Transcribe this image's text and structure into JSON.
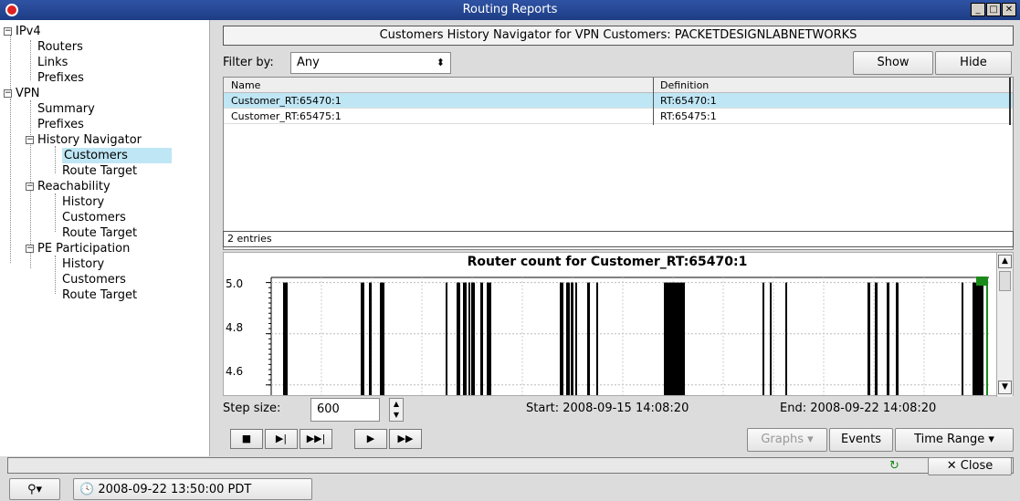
{
  "window": {
    "title": "Routing Reports",
    "controls": [
      "_",
      "□",
      "✕"
    ]
  },
  "tree": {
    "ipv4": "IPv4",
    "routers": "Routers",
    "links": "Links",
    "prefixes4": "Prefixes",
    "vpn": "VPN",
    "summary": "Summary",
    "prefixes_vpn": "Prefixes",
    "history_nav": "History Navigator",
    "hn_customers": "Customers",
    "hn_route_target": "Route Target",
    "reachability": "Reachability",
    "r_history": "History",
    "r_customers": "Customers",
    "r_route_target": "Route Target",
    "pe_participation": "PE Participation",
    "p_history": "History",
    "p_customers": "Customers",
    "p_route_target": "Route Target"
  },
  "header": {
    "title": "Customers History Navigator for VPN Customers: PACKETDESIGNLABNETWORKS"
  },
  "filter": {
    "label": "Filter by:",
    "value": "Any",
    "show_label": "Show",
    "hide_label": "Hide"
  },
  "table": {
    "columns": [
      "Name",
      "Definition"
    ],
    "rows": [
      {
        "name": "Customer_RT:65470:1",
        "definition": "RT:65470:1"
      },
      {
        "name": "Customer_RT:65475:1",
        "definition": "RT:65475:1"
      }
    ],
    "entries": "2 entries"
  },
  "chart_data": {
    "type": "bar",
    "title": "Router count for Customer_RT:65470:1",
    "ytick_labels": [
      "5.0",
      "4.8",
      "4.6"
    ],
    "ylim": [
      4.56,
      5.02
    ],
    "value": 5.0,
    "fill_color": "#000000",
    "marker_color": "#1a8a1a"
  },
  "controls": {
    "step_label": "Step size:",
    "step_value": "600",
    "start": "Start: 2008-09-15 14:08:20",
    "end": "End: 2008-09-22 14:08:20",
    "graphs_label": "Graphs",
    "events_label": "Events",
    "time_range_label": "Time Range",
    "stop_icon": "■",
    "step_icon": "▶|",
    "fast_step_icon": "▶▶|",
    "play_icon": "▶",
    "fast_play_icon": "▶▶"
  },
  "status": {
    "close_label": "Close",
    "timestamp": "2008-09-22 13:50:00 PDT"
  }
}
